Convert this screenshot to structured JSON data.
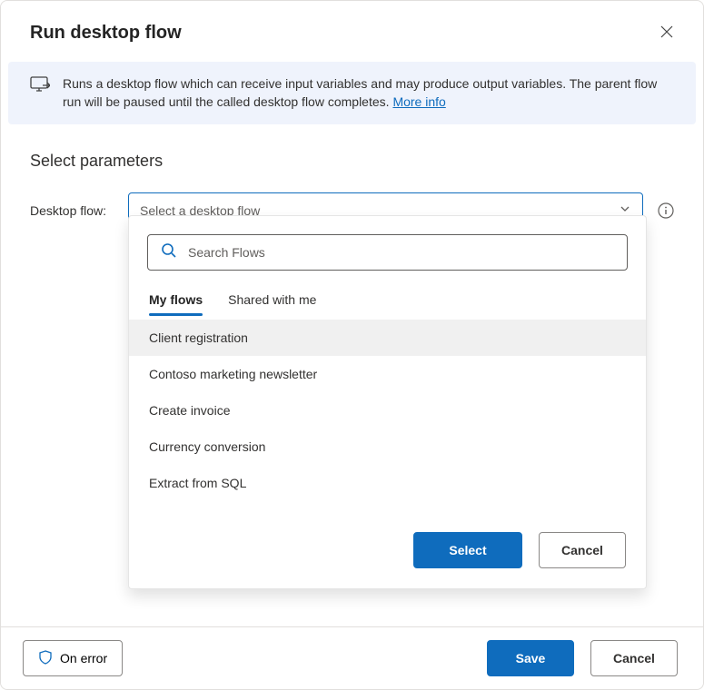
{
  "dialog": {
    "title": "Run desktop flow",
    "description_prefix": "Runs a desktop flow which can receive input variables and may produce output variables. The parent flow run will be paused until the called desktop flow completes. ",
    "more_info_label": "More info"
  },
  "section": {
    "title": "Select parameters"
  },
  "field": {
    "label": "Desktop flow:",
    "placeholder": "Select a desktop flow"
  },
  "popup": {
    "search_placeholder": "Search Flows",
    "tabs": {
      "my_flows": "My flows",
      "shared": "Shared with me"
    },
    "items": [
      "Client registration",
      "Contoso marketing newsletter",
      "Create invoice",
      "Currency conversion",
      "Extract from SQL"
    ],
    "select_label": "Select",
    "cancel_label": "Cancel"
  },
  "footer": {
    "on_error_label": "On error",
    "save_label": "Save",
    "cancel_label": "Cancel"
  },
  "colors": {
    "accent": "#0f6cbd"
  }
}
